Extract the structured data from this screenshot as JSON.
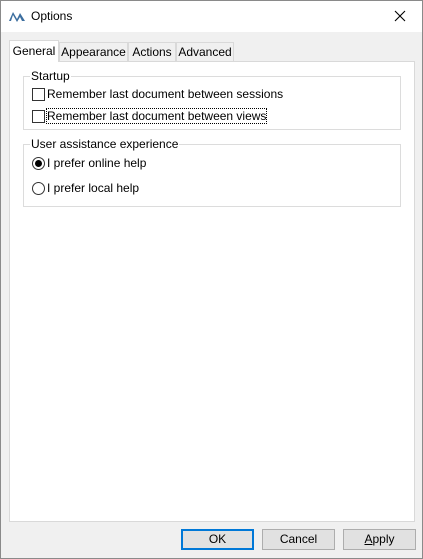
{
  "window": {
    "title": "Options"
  },
  "tabs": [
    {
      "label": "General",
      "active": true
    },
    {
      "label": "Appearance",
      "active": false
    },
    {
      "label": "Actions",
      "active": false
    },
    {
      "label": "Advanced",
      "active": false
    }
  ],
  "startup": {
    "title": "Startup",
    "options": [
      {
        "label": "Remember last document between sessions",
        "checked": false
      },
      {
        "label": "Remember last document between views",
        "checked": false,
        "focused": true
      }
    ]
  },
  "assistance": {
    "title": "User assistance experience",
    "options": [
      {
        "label": "I prefer online help",
        "selected": true
      },
      {
        "label": "I prefer local help",
        "selected": false
      }
    ]
  },
  "buttons": {
    "ok": "OK",
    "cancel": "Cancel",
    "apply": "Apply"
  },
  "icons": {
    "app": "app-logo-icon",
    "close": "close-icon"
  },
  "colors": {
    "accent": "#0078d7",
    "logo": "#3c6e9f",
    "dialog_bg": "#f0f0f0"
  }
}
